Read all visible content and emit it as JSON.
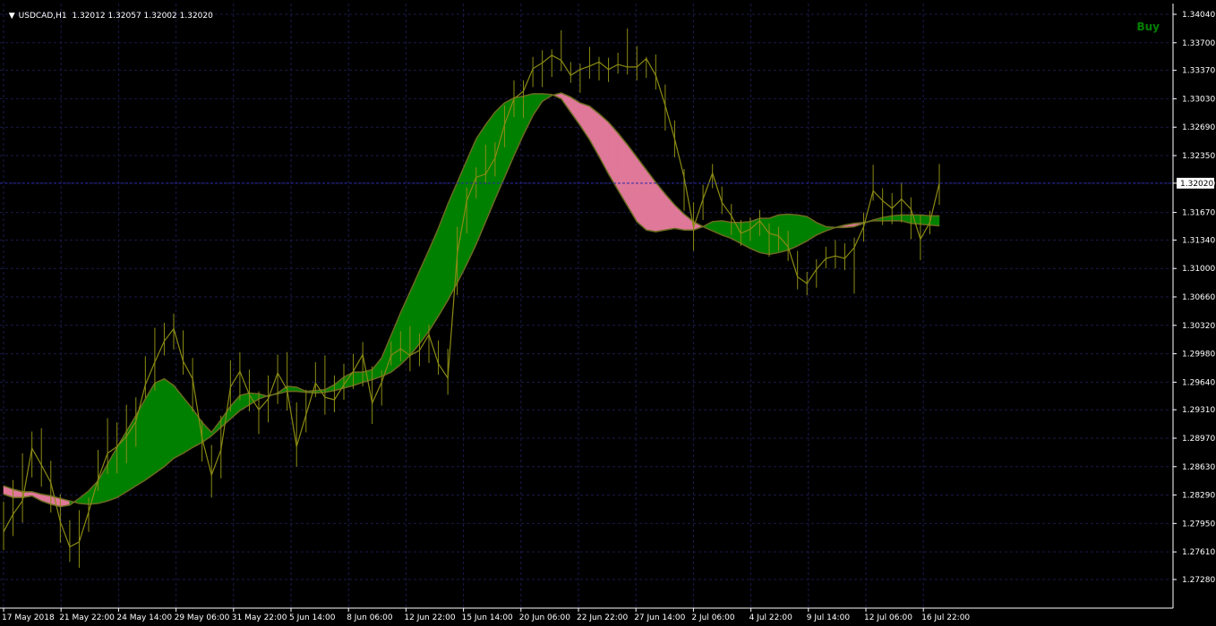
{
  "header": {
    "symbol": "USDCAD,H1",
    "open": "1.32012",
    "high": "1.32057",
    "low": "1.32002",
    "close": "1.32020"
  },
  "signal_label": "Buy",
  "current_price": "1.32020",
  "colors": {
    "background": "#000000",
    "grid": "#1a1a4a",
    "price_line": "#8b8b14",
    "bull_fill": "#008000",
    "bear_fill": "#e0789a",
    "edge": "#6b6b20",
    "axis_text": "#ffffff"
  },
  "chart_data": {
    "type": "line",
    "title": "",
    "xlabel": "",
    "ylabel": "",
    "ylim": [
      1.2728,
      1.3404
    ],
    "grid": true,
    "y_ticks": [
      "1.34040",
      "1.33700",
      "1.33370",
      "1.33030",
      "1.32690",
      "1.32350",
      "1.32020",
      "1.31670",
      "1.31340",
      "1.31000",
      "1.30660",
      "1.30320",
      "1.29980",
      "1.29640",
      "1.29310",
      "1.28970",
      "1.28630",
      "1.28290",
      "1.27950",
      "1.27610",
      "1.27280"
    ],
    "x_ticks": [
      "17 May 2018",
      "21 May 22:00",
      "24 May 14:00",
      "29 May 06:00",
      "31 May 22:00",
      "5 Jun 14:00",
      "8 Jun 06:00",
      "12 Jun 22:00",
      "15 Jun 14:00",
      "20 Jun 06:00",
      "22 Jun 22:00",
      "27 Jun 14:00",
      "2 Jul 06:00",
      "4 Jul 22:00",
      "9 Jul 14:00",
      "12 Jul 06:00",
      "16 Jul 22:00"
    ],
    "series": [
      {
        "values": [
          1.2785,
          1.2806,
          1.2822,
          1.2885,
          1.2865,
          1.2844,
          1.2797,
          1.2767,
          1.2773,
          1.2809,
          1.2848,
          1.2879,
          1.2887,
          1.2899,
          1.2917,
          1.2961,
          1.2988,
          1.3013,
          1.3028,
          1.2989,
          1.2968,
          1.2897,
          1.2853,
          1.2883,
          1.2958,
          1.2977,
          1.2949,
          1.2931,
          1.2944,
          1.2975,
          1.2955,
          1.2887,
          1.2925,
          1.2963,
          1.2946,
          1.2943,
          1.2961,
          1.2977,
          1.2997,
          1.2939,
          1.2964,
          1.2996,
          1.3004,
          1.2996,
          1.3002,
          1.3021,
          1.2986,
          1.2969,
          1.3118,
          1.3181,
          1.3209,
          1.3213,
          1.3232,
          1.3272,
          1.3303,
          1.3312,
          1.3339,
          1.3346,
          1.3355,
          1.3349,
          1.3331,
          1.3338,
          1.3342,
          1.3347,
          1.3338,
          1.3344,
          1.3341,
          1.3341,
          1.3351,
          1.3331,
          1.3295,
          1.3255,
          1.3209,
          1.3149,
          1.3183,
          1.3214,
          1.3179,
          1.3163,
          1.3142,
          1.3147,
          1.3157,
          1.3142,
          1.3139,
          1.3126,
          1.309,
          1.3082,
          1.3099,
          1.3112,
          1.3115,
          1.3112,
          1.3125,
          1.315,
          1.3193,
          1.3181,
          1.3172,
          1.3183,
          1.3171,
          1.3135,
          1.3155,
          1.3202
        ],
        "high": [
          1.2821,
          1.2847,
          1.2879,
          1.2905,
          1.2909,
          1.287,
          1.283,
          1.2799,
          1.2811,
          1.2826,
          1.2883,
          1.2921,
          1.2916,
          1.2937,
          1.2946,
          1.2995,
          1.3029,
          1.3035,
          1.3046,
          1.3026,
          1.2993,
          1.2918,
          1.2889,
          1.2924,
          1.299,
          1.3,
          1.2979,
          1.2953,
          1.2972,
          1.2997,
          1.3,
          1.294,
          1.2955,
          1.2988,
          1.2996,
          1.2972,
          1.2986,
          1.2998,
          1.3012,
          1.2983,
          1.2978,
          1.3013,
          1.3025,
          1.3031,
          1.3022,
          1.3033,
          1.3014,
          1.3004,
          1.315,
          1.3197,
          1.3221,
          1.3248,
          1.3251,
          1.3295,
          1.3325,
          1.3325,
          1.3353,
          1.3361,
          1.3362,
          1.3385,
          1.3347,
          1.3345,
          1.3365,
          1.3353,
          1.3352,
          1.3358,
          1.3387,
          1.3366,
          1.3353,
          1.3356,
          1.332,
          1.3277,
          1.3219,
          1.3179,
          1.32,
          1.3225,
          1.3198,
          1.3177,
          1.3158,
          1.3161,
          1.317,
          1.3154,
          1.315,
          1.3145,
          1.3121,
          1.3096,
          1.3111,
          1.3126,
          1.3134,
          1.313,
          1.3137,
          1.3167,
          1.3224,
          1.3196,
          1.319,
          1.3203,
          1.3185,
          1.3164,
          1.3169,
          1.3225
        ],
        "low": [
          1.2763,
          1.278,
          1.2796,
          1.285,
          1.2839,
          1.2808,
          1.2772,
          1.2749,
          1.2742,
          1.2785,
          1.2834,
          1.2854,
          1.2855,
          1.2867,
          1.2887,
          1.2945,
          1.2954,
          1.2996,
          1.3003,
          1.2973,
          1.2929,
          1.2869,
          1.2826,
          1.2849,
          1.2929,
          1.2942,
          1.2929,
          1.2902,
          1.2916,
          1.2938,
          1.293,
          1.2863,
          1.2904,
          1.2946,
          1.2925,
          1.2928,
          1.2943,
          1.2956,
          1.2959,
          1.2914,
          1.2936,
          1.2984,
          1.2989,
          1.2977,
          1.2983,
          1.2987,
          1.2973,
          1.2949,
          1.3068,
          1.3142,
          1.3184,
          1.3202,
          1.321,
          1.3245,
          1.3281,
          1.328,
          1.3317,
          1.3317,
          1.3329,
          1.3336,
          1.3322,
          1.331,
          1.3327,
          1.3325,
          1.3323,
          1.3333,
          1.3332,
          1.3325,
          1.3328,
          1.3314,
          1.3265,
          1.3233,
          1.3169,
          1.3121,
          1.3158,
          1.3196,
          1.3165,
          1.314,
          1.3127,
          1.3133,
          1.3139,
          1.3114,
          1.3121,
          1.3109,
          1.3075,
          1.3068,
          1.3077,
          1.31,
          1.31,
          1.3098,
          1.307,
          1.3132,
          1.3181,
          1.3152,
          1.3153,
          1.3155,
          1.3135,
          1.311,
          1.3141,
          1.3176
        ]
      },
      {
        "values": [
          1.283,
          1.2826,
          1.2826,
          1.2828,
          1.2822,
          1.2818,
          1.2815,
          1.2817,
          1.2825,
          1.2834,
          1.2846,
          1.2866,
          1.2886,
          1.2905,
          1.2924,
          1.2944,
          1.2963,
          1.2968,
          1.296,
          1.2946,
          1.2932,
          1.2916,
          1.2904,
          1.2919,
          1.2935,
          1.2948,
          1.2951,
          1.295,
          1.2947,
          1.2951,
          1.2959,
          1.2958,
          1.2953,
          1.2954,
          1.2955,
          1.2961,
          1.297,
          1.2976,
          1.2976,
          1.2979,
          1.2993,
          1.302,
          1.3047,
          1.3072,
          1.3097,
          1.3122,
          1.3148,
          1.3177,
          1.3203,
          1.3229,
          1.3255,
          1.3272,
          1.3287,
          1.3298,
          1.3304,
          1.3306,
          1.3309,
          1.3309,
          1.3308,
          1.3303,
          1.3287,
          1.3271,
          1.3254,
          1.3234,
          1.3213,
          1.3194,
          1.3175,
          1.3156,
          1.3146,
          1.3144,
          1.3146,
          1.3148,
          1.3146,
          1.3146,
          1.315,
          1.3156,
          1.3157,
          1.3155,
          1.3155,
          1.3156,
          1.316,
          1.316,
          1.3164,
          1.3165,
          1.3164,
          1.3162,
          1.3155,
          1.315,
          1.3149,
          1.3149,
          1.315,
          1.3154,
          1.3158,
          1.3161,
          1.3163,
          1.3164,
          1.3164,
          1.3164,
          1.3163,
          1.3163
        ],
        "name": ""
      },
      {
        "values": [
          1.284,
          1.2836,
          1.2833,
          1.2833,
          1.283,
          1.2828,
          1.2825,
          1.2822,
          1.2819,
          1.2818,
          1.2819,
          1.2822,
          1.2826,
          1.2833,
          1.284,
          1.2847,
          1.2855,
          1.2863,
          1.2873,
          1.2879,
          1.2886,
          1.2892,
          1.29,
          1.291,
          1.292,
          1.293,
          1.2937,
          1.2944,
          1.2948,
          1.295,
          1.2953,
          1.2953,
          1.2952,
          1.2951,
          1.2952,
          1.2954,
          1.2957,
          1.296,
          1.2964,
          1.2967,
          1.2971,
          1.2976,
          1.2985,
          1.2996,
          1.301,
          1.3025,
          1.3043,
          1.3062,
          1.3083,
          1.3105,
          1.3129,
          1.3156,
          1.3183,
          1.3209,
          1.3235,
          1.326,
          1.3283,
          1.33,
          1.3307,
          1.331,
          1.3305,
          1.3298,
          1.3294,
          1.3285,
          1.3275,
          1.3262,
          1.3248,
          1.3233,
          1.3218,
          1.3203,
          1.3189,
          1.3176,
          1.3165,
          1.3156,
          1.315,
          1.3145,
          1.314,
          1.3136,
          1.313,
          1.3124,
          1.3119,
          1.3117,
          1.3119,
          1.3122,
          1.3127,
          1.3133,
          1.314,
          1.3145,
          1.3149,
          1.3152,
          1.3154,
          1.3155,
          1.3157,
          1.3157,
          1.3157,
          1.3157,
          1.3154,
          1.3153,
          1.3152,
          1.3151
        ],
        "name": ""
      }
    ]
  }
}
